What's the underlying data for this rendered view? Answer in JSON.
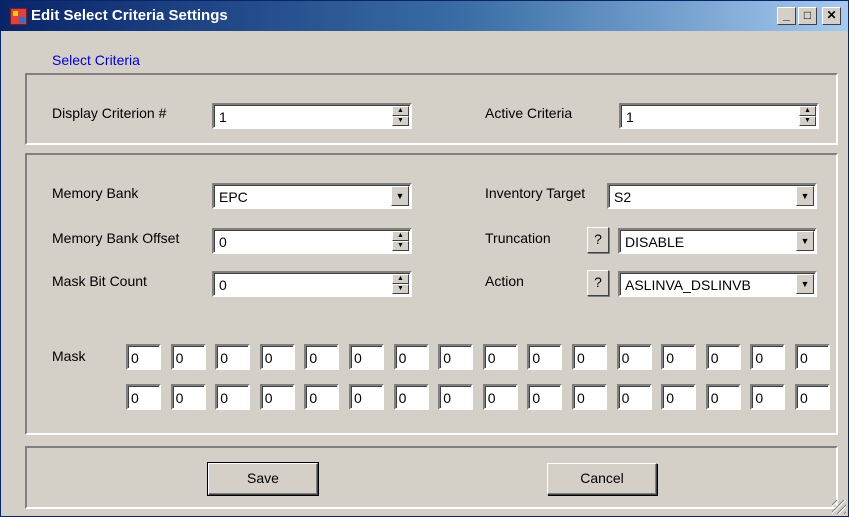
{
  "window": {
    "title": "Edit Select Criteria Settings"
  },
  "title_buttons": {
    "minimize": "_",
    "maximize": "□",
    "close": "✕"
  },
  "link": {
    "label": "Select Criteria"
  },
  "criteria": {
    "display_label": "Display Criterion #",
    "display_value": "1",
    "active_label": "Active Criteria",
    "active_value": "1"
  },
  "settings": {
    "memory_bank_label": "Memory Bank",
    "memory_bank_value": "EPC",
    "offset_label": "Memory Bank Offset",
    "offset_value": "0",
    "mask_bit_label": "Mask Bit Count",
    "mask_bit_value": "0",
    "inventory_label": "Inventory Target",
    "inventory_value": "S2",
    "truncation_label": "Truncation",
    "truncation_value": "DISABLE",
    "action_label": "Action",
    "action_value": "ASLINVA_DSLINVB",
    "help_label": "?"
  },
  "mask": {
    "label": "Mask",
    "row1": [
      "0",
      "0",
      "0",
      "0",
      "0",
      "0",
      "0",
      "0",
      "0",
      "0",
      "0",
      "0",
      "0",
      "0",
      "0",
      "0"
    ],
    "row2": [
      "0",
      "0",
      "0",
      "0",
      "0",
      "0",
      "0",
      "0",
      "0",
      "0",
      "0",
      "0",
      "0",
      "0",
      "0",
      "0"
    ]
  },
  "footer": {
    "save": "Save",
    "cancel": "Cancel"
  },
  "icons": {
    "app": "app-icon",
    "spin_up": "▲",
    "spin_down": "▼",
    "dropdown": "▼"
  },
  "colors": {
    "face": "#d4d0c8",
    "title_start": "#0a246a",
    "title_end": "#a6caf0",
    "link": "#0000cc"
  }
}
